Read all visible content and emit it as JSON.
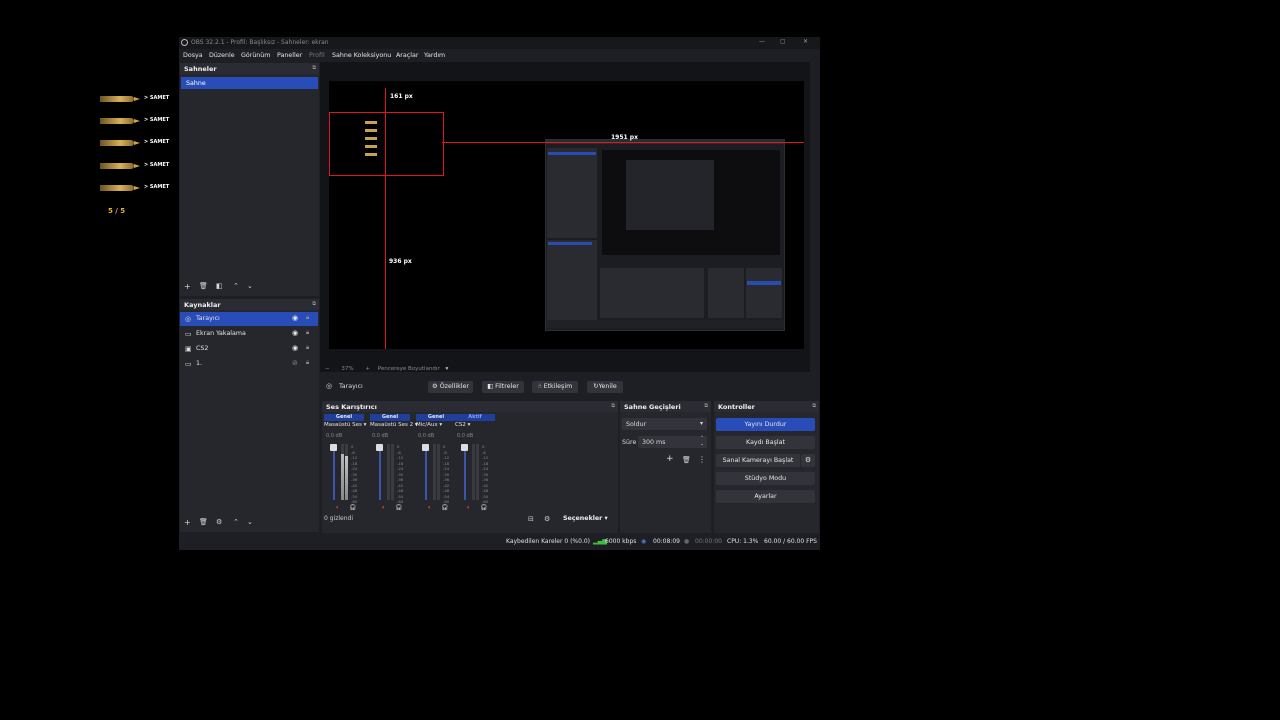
{
  "overlay": {
    "kills": [
      "> SAMET",
      "> SAMET",
      "> SAMET",
      "> SAMET",
      "> SAMET"
    ],
    "count": "5 / 5"
  },
  "window": {
    "title": "OBS 32.2.1 - Profil: Başlıksız - Sahneler: ekran",
    "controls": [
      "—",
      "▢",
      "✕"
    ]
  },
  "menu": [
    "Dosya",
    "Düzenle",
    "Görünüm",
    "Paneller",
    "Profil",
    "Sahne Koleksiyonu",
    "Araçlar",
    "Yardım"
  ],
  "scenes": {
    "title": "Sahneler",
    "items": [
      "Sahne"
    ]
  },
  "sources": {
    "title": "Kaynaklar",
    "items": [
      {
        "icon": "◎",
        "label": "Tarayıcı"
      },
      {
        "icon": "▭",
        "label": "Ekran Yakalama"
      },
      {
        "icon": "▣",
        "label": "CS2"
      },
      {
        "icon": "▭",
        "label": "1."
      }
    ]
  },
  "preview": {
    "labels": {
      "top": "161 px",
      "right": "1951 px",
      "left": "936 px"
    },
    "zoom": "37%",
    "fit": "Pencereye Boyutlandır"
  },
  "context": {
    "source": "Tarayıcı",
    "buttons": [
      "Özellikler",
      "Filtreler",
      "Etkileşim",
      "Yenile"
    ]
  },
  "mixer": {
    "title": "Ses Karıştırıcı",
    "channels": [
      {
        "tab": "Genel",
        "name": "Masaüstü Ses",
        "db": "0.0 dB"
      },
      {
        "tab": "Genel",
        "name": "Masaüstü Ses 2",
        "db": "0.0 dB"
      },
      {
        "tab": "Genel",
        "name": "Mic/Aux",
        "db": "0.0 dB"
      },
      {
        "tab": "Aktif",
        "name": "CS2",
        "db": "0.0 dB"
      }
    ],
    "scale": [
      "0",
      "-6",
      "-12",
      "-18",
      "-24",
      "-30",
      "-36",
      "-42",
      "-48",
      "-54",
      "-60"
    ],
    "hidden": "0 gizlendi",
    "options": "Seçenekler"
  },
  "transitions": {
    "title": "Sahne Geçişleri",
    "type": "Soldur",
    "duration_label": "Süre",
    "duration": "300 ms"
  },
  "controls": {
    "title": "Kontroller",
    "buttons": [
      "Yayını Durdur",
      "Kaydı Başlat",
      "Sanal Kamerayı Başlat",
      "Stüdyo Modu",
      "Ayarlar"
    ]
  },
  "status": {
    "dropped": "Kaybedilen Kareler 0 (%0.0)",
    "bitrate": "6000 kbps",
    "stream_time": "00:08:09",
    "rec_time": "00:00:00",
    "cpu": "CPU: 1.3%",
    "fps": "60.00 / 60.00 FPS"
  },
  "colors": {
    "accent": "#284cb8",
    "red_guides": "#e0161e"
  }
}
